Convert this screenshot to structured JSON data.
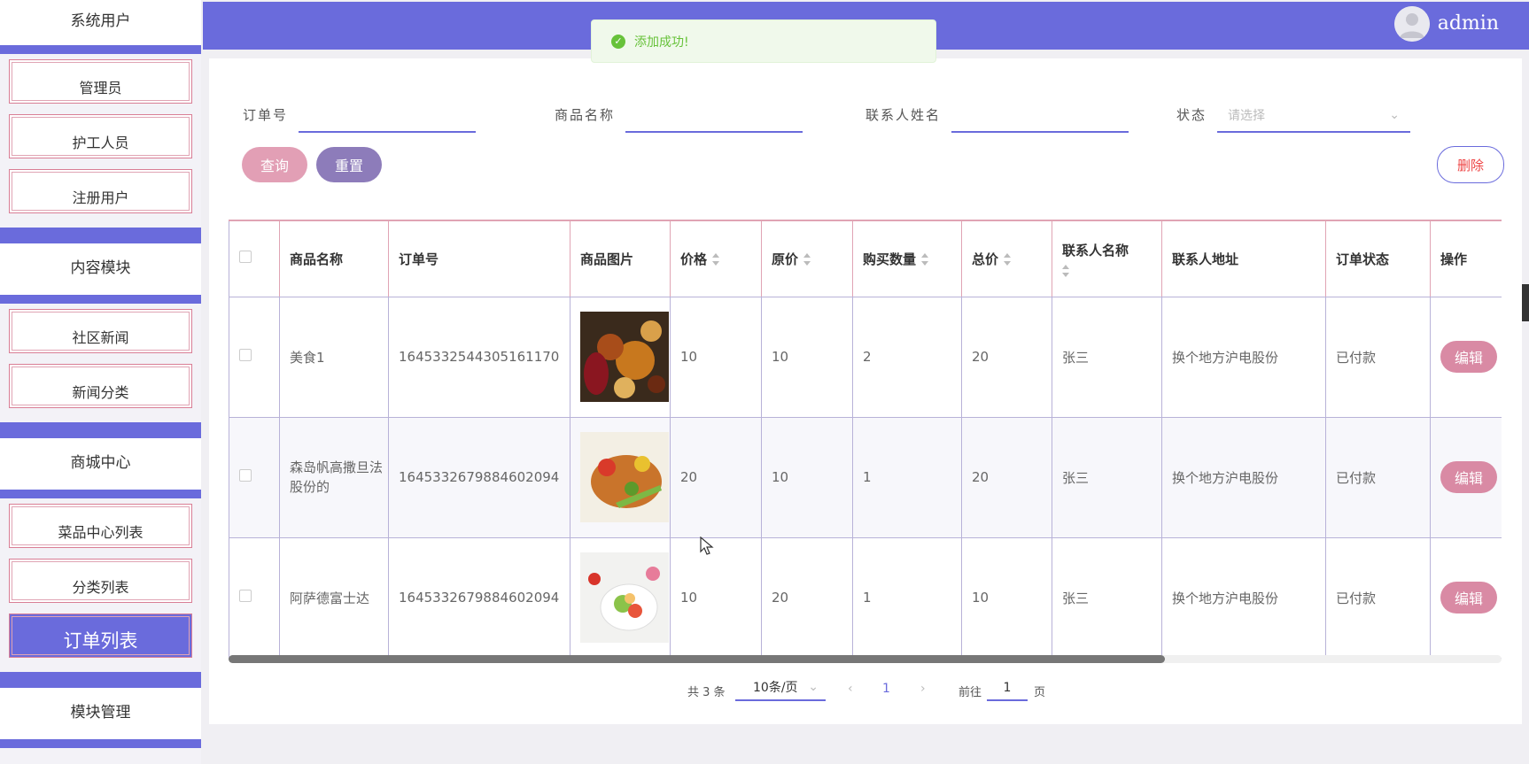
{
  "sidebar": {
    "groups": [
      {
        "title": "系统用户",
        "items": [
          "管理员",
          "护工人员",
          "注册用户"
        ]
      },
      {
        "title": "内容模块",
        "items": [
          "社区新闻",
          "新闻分类"
        ]
      },
      {
        "title": "商城中心",
        "items": [
          "菜品中心列表",
          "分类列表",
          "订单列表"
        ]
      },
      {
        "title": "模块管理",
        "items": []
      }
    ],
    "active_item": "订单列表"
  },
  "header": {
    "username": "admin"
  },
  "toast": {
    "message": "添加成功!"
  },
  "search": {
    "order_no_label": "订单号",
    "product_name_label": "商品名称",
    "contact_name_label": "联系人姓名",
    "status_label": "状态",
    "status_placeholder": "请选择",
    "query_button": "查询",
    "reset_button": "重置",
    "delete_button": "删除"
  },
  "table": {
    "columns": [
      "商品名称",
      "订单号",
      "商品图片",
      "价格",
      "原价",
      "购买数量",
      "总价",
      "联系人名称",
      "联系人地址",
      "订单状态",
      "操作"
    ],
    "rows": [
      {
        "name": "美食1",
        "order_no": "1645332544305161170",
        "price": "10",
        "orig_price": "10",
        "qty": "2",
        "total": "20",
        "contact": "张三",
        "address": "换个地方沪电股份",
        "status": "已付款",
        "action": "编辑"
      },
      {
        "name": "森岛帆高撒旦法股份的",
        "order_no": "1645332679884602094",
        "price": "20",
        "orig_price": "10",
        "qty": "1",
        "total": "20",
        "contact": "张三",
        "address": "换个地方沪电股份",
        "status": "已付款",
        "action": "编辑"
      },
      {
        "name": "阿萨德富士达",
        "order_no": "1645332679884602094",
        "price": "10",
        "orig_price": "20",
        "qty": "1",
        "total": "10",
        "contact": "张三",
        "address": "换个地方沪电股份",
        "status": "已付款",
        "action": "编辑"
      }
    ]
  },
  "pagination": {
    "total_text": "共 3 条",
    "page_size": "10条/页",
    "current_page": "1",
    "goto_label": "前往",
    "goto_value": "1",
    "page_unit": "页"
  },
  "colors": {
    "primary": "#6a6bdc",
    "query": "#e29fb5",
    "reset": "#8d7cba",
    "edit": "#d98aa4",
    "success": "#67c23a"
  }
}
